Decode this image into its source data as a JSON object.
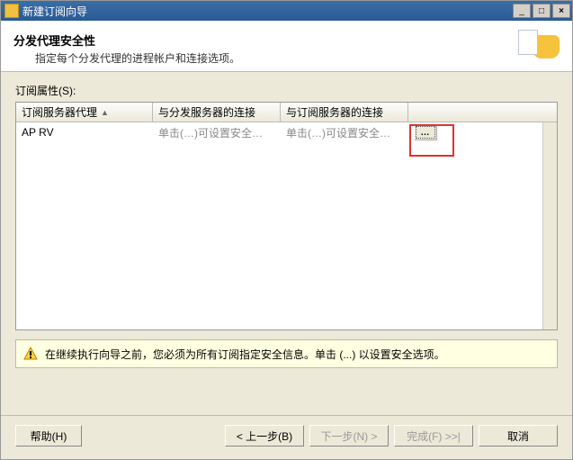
{
  "window": {
    "title": "新建订阅向导"
  },
  "header": {
    "title": "分发代理安全性",
    "subtitle": "指定每个分发代理的进程帐户和连接选项。"
  },
  "list": {
    "label": "订阅属性(S):",
    "columns": {
      "agent": "订阅服务器代理",
      "dist_conn": "与分发服务器的连接",
      "sub_conn": "与订阅服务器的连接"
    },
    "rows": [
      {
        "agent": "AP   RV",
        "dist_conn": "单击(…)可设置安全…",
        "sub_conn": "单击(…)可设置安全…",
        "btn": "…"
      }
    ]
  },
  "info": {
    "text": "在继续执行向导之前，您必须为所有订阅指定安全信息。单击 (...) 以设置安全选项。"
  },
  "footer": {
    "help": "帮助(H)",
    "back": "< 上一步(B)",
    "next": "下一步(N) >",
    "finish": "完成(F) >>|",
    "cancel": "取消"
  }
}
